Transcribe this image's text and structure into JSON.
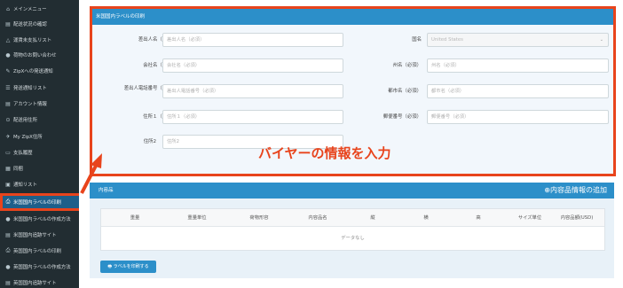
{
  "sidebar": {
    "items": [
      {
        "label": "メインメニュー",
        "icon": "home-icon"
      },
      {
        "label": "配送状況の確認",
        "icon": "list-icon"
      },
      {
        "label": "運賃未支払リスト",
        "icon": "bell-icon"
      },
      {
        "label": "荷物のお問い合わせ",
        "icon": "question-icon"
      },
      {
        "label": "ZipXへの発送通知",
        "icon": "edit-icon"
      },
      {
        "label": "発送通知リスト",
        "icon": "list-icon"
      },
      {
        "label": "アカウント情報",
        "icon": "list-icon"
      },
      {
        "label": "配送用住所",
        "icon": "pin-icon"
      },
      {
        "label": "My ZipX住所",
        "icon": "plane-icon"
      },
      {
        "label": "支払履歴",
        "icon": "card-icon"
      },
      {
        "label": "同梱",
        "icon": "grid-icon"
      },
      {
        "label": "通知リスト",
        "icon": "lock-icon"
      },
      {
        "label": "米国国内ラベルの印刷",
        "icon": "print-icon"
      },
      {
        "label": "米国国内ラベルの作成方法",
        "icon": "question-icon"
      },
      {
        "label": "米国国内追跡サイト",
        "icon": "list-icon"
      },
      {
        "label": "英国国内ラベルの印刷",
        "icon": "print-icon"
      },
      {
        "label": "英国国内ラベルの作成方法",
        "icon": "question-icon"
      },
      {
        "label": "英国国内追跡サイト",
        "icon": "list-icon"
      }
    ],
    "active_index": 12
  },
  "label_panel": {
    "title": "米国国内ラベルの印刷",
    "sender_name": {
      "label": "差出人名（必須）",
      "placeholder": "差出人名（必須）"
    },
    "company": {
      "label": "会社名（必須）",
      "placeholder": "会社名（必須）"
    },
    "sender_phone": {
      "label": "差出人電話番号（必須）",
      "placeholder": "差出人電話番号（必須）"
    },
    "address1": {
      "label": "住所１（必須）",
      "placeholder": "住所１（必須）"
    },
    "address2": {
      "label": "住所2",
      "placeholder": "住所2"
    },
    "country": {
      "label": "国名",
      "value": "United States"
    },
    "state": {
      "label": "州名（必須）",
      "placeholder": "州名（必須）"
    },
    "city": {
      "label": "都市名（必須）",
      "placeholder": "都市名（必須）"
    },
    "zip": {
      "label": "郵便番号（必須）",
      "placeholder": "郵便番号（必須）"
    }
  },
  "annotation": {
    "text": "バイヤーの情報を入力",
    "color": "#e8441c"
  },
  "contents_panel": {
    "title": "内容品",
    "add_button": "⊕内容品情報の追加",
    "columns": [
      "重量",
      "重量単位",
      "荷物形容",
      "内容品名",
      "縦",
      "横",
      "高",
      "サイズ単位",
      "内容品額(USD)"
    ],
    "empty_text": "データなし",
    "print_button": "🖶 ラベルを印刷する"
  },
  "colors": {
    "accent": "#2c8fc9",
    "sidebar": "#222d32",
    "highlight": "#e8441c"
  }
}
